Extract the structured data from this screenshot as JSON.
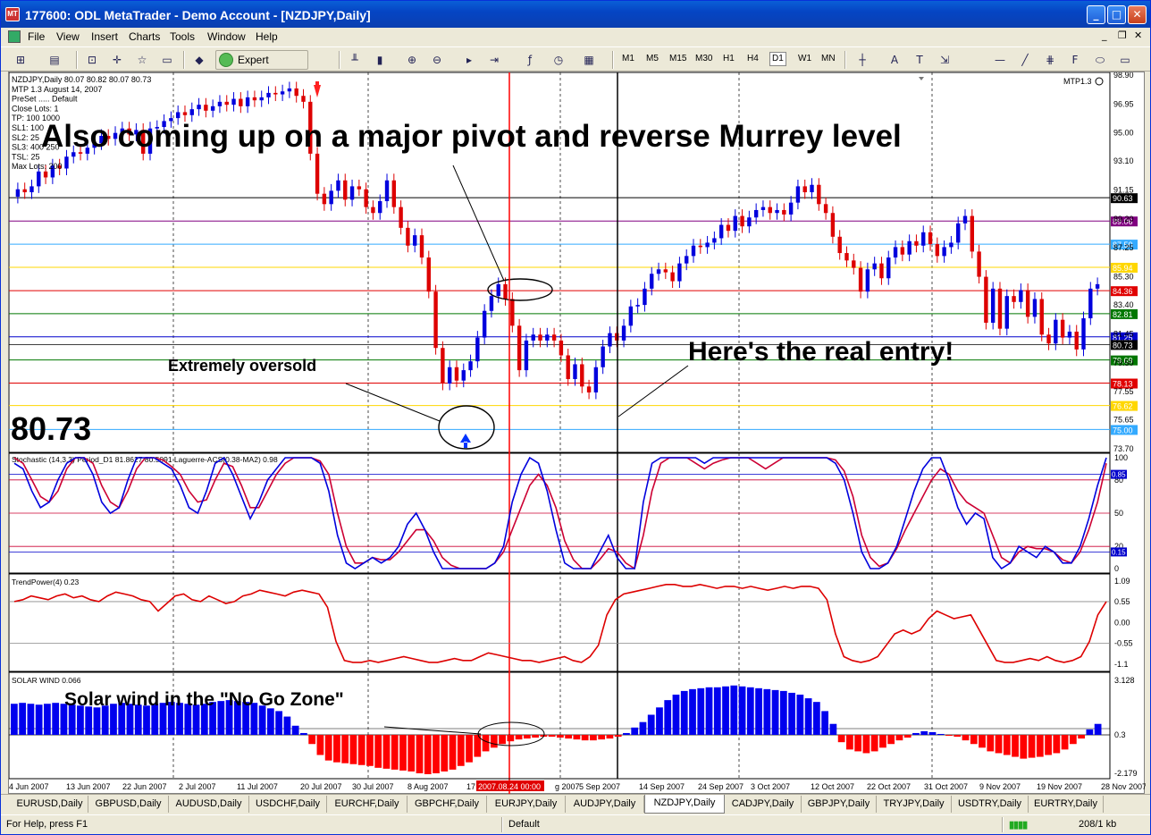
{
  "window": {
    "title": "177600: ODL MetaTrader - Demo Account - [NZDJPY,Daily]",
    "app_icon": "MT"
  },
  "menu": [
    "File",
    "View",
    "Insert",
    "Charts",
    "Tools",
    "Window",
    "Help"
  ],
  "toolbar": {
    "expert_advisors": "Expert Advisors",
    "timeframes": [
      "M1",
      "M5",
      "M15",
      "M30",
      "H1",
      "H4",
      "D1",
      "W1",
      "MN"
    ],
    "active_timeframe": "D1"
  },
  "chart": {
    "header": [
      "NZDJPY,Daily  80.07 80.82 80.07 80.73",
      "MTP 1.3  August 14, 2007",
      "PreSet ..... Default",
      "Close Lots:  1",
      "TP:  100  1000",
      "SL1:  100",
      "SL2:  25",
      "SL3:  400  250",
      "TSL:  25",
      "Max Lots:  200"
    ],
    "mtp_label": "MTP1.3",
    "big_price": "80.73",
    "price_scale": [
      "98.90",
      "96.95",
      "95.00",
      "93.10",
      "91.15",
      "89.20",
      "87.25",
      "85.30",
      "83.40",
      "81.45",
      "79.50",
      "77.55",
      "75.65",
      "73.70"
    ],
    "murrey_levels": [
      {
        "label": "90.63",
        "bg": "#000000",
        "fg": "#ffffff",
        "line": "#000000"
      },
      {
        "label": "89.06",
        "bg": "#800080",
        "fg": "#ffffff",
        "line": "#800080"
      },
      {
        "label": "87.50",
        "bg": "#33aaff",
        "fg": "#ffffff",
        "line": "#33aaff"
      },
      {
        "label": "85.94",
        "bg": "#ffd700",
        "fg": "#ffffff",
        "line": "#ffd700"
      },
      {
        "label": "84.36",
        "bg": "#e00000",
        "fg": "#ffffff",
        "line": "#e00000"
      },
      {
        "label": "82.81",
        "bg": "#007700",
        "fg": "#ffffff",
        "line": "#007700"
      },
      {
        "label": "81.25",
        "bg": "#0000cc",
        "fg": "#ffffff",
        "line": "#0000cc"
      },
      {
        "label": "80.73",
        "bg": "#000000",
        "fg": "#ffffff",
        "line": "#000000"
      },
      {
        "label": "79.69",
        "bg": "#007700",
        "fg": "#ffffff",
        "line": "#007700"
      },
      {
        "label": "78.13",
        "bg": "#e00000",
        "fg": "#ffffff",
        "line": "#e00000"
      },
      {
        "label": "76.62",
        "bg": "#ffd700",
        "fg": "#ffffff",
        "line": "#ffd700"
      },
      {
        "label": "75.00",
        "bg": "#33aaff",
        "fg": "#ffffff",
        "line": "#33aaff"
      }
    ],
    "stoch_label": "Stochastic (14,3,3) Period_D1 81.8627 80.5091  Laguerre-ACS(0.38-MA2) 0.98",
    "stoch_scale": [
      "100",
      "80",
      "50",
      "20",
      "0"
    ],
    "stoch_badges": [
      "0.85",
      "0.15"
    ],
    "trend_label": "TrendPower(4) 0.23",
    "trend_scale": [
      "1.09",
      "0.55",
      "0.00",
      "-0.55",
      "-1.1"
    ],
    "solar_label": "SOLAR WIND 0.066",
    "solar_scale": [
      "3.128",
      "0.3",
      "-2.179"
    ],
    "dates": [
      "4 Jun 2007",
      "13 Jun 2007",
      "22 Jun 2007",
      "2 Jul 2007",
      "11 Jul 2007",
      "20 Jul 2007",
      "30 Jul 2007",
      "8 Aug 2007",
      "17",
      "2007.08.24 00:00",
      "g 2007",
      "5 Sep 2007",
      "14 Sep 2007",
      "24 Sep 2007",
      "3 Oct 2007",
      "12 Oct 2007",
      "22 Oct 2007",
      "31 Oct 2007",
      "9 Nov 2007",
      "19 Nov 2007",
      "28 Nov 2007"
    ]
  },
  "notes": {
    "pivot": "Also coming up on a major pivot and reverse Murrey level",
    "oversold": "Extremely oversold",
    "entry": "Here's the real entry!",
    "solar": "Solar wind in the \"No Go Zone\""
  },
  "tabs": [
    "EURUSD,Daily",
    "GBPUSD,Daily",
    "AUDUSD,Daily",
    "USDCHF,Daily",
    "EURCHF,Daily",
    "GBPCHF,Daily",
    "EURJPY,Daily",
    "AUDJPY,Daily",
    "NZDJPY,Daily",
    "CADJPY,Daily",
    "GBPJPY,Daily",
    "TRYJPY,Daily",
    "USDTRY,Daily",
    "EURTRY,Daily"
  ],
  "active_tab": "NZDJPY,Daily",
  "status": {
    "help": "For Help, press F1",
    "profile": "Default",
    "traffic": "208/1 kb"
  },
  "colors": {
    "bull": "#0000dd",
    "bear": "#dd0000",
    "stoch_main": "#0000dd",
    "stoch_signal": "#cc0033",
    "trend": "#dd0000",
    "cursor": "#ff0000"
  }
}
